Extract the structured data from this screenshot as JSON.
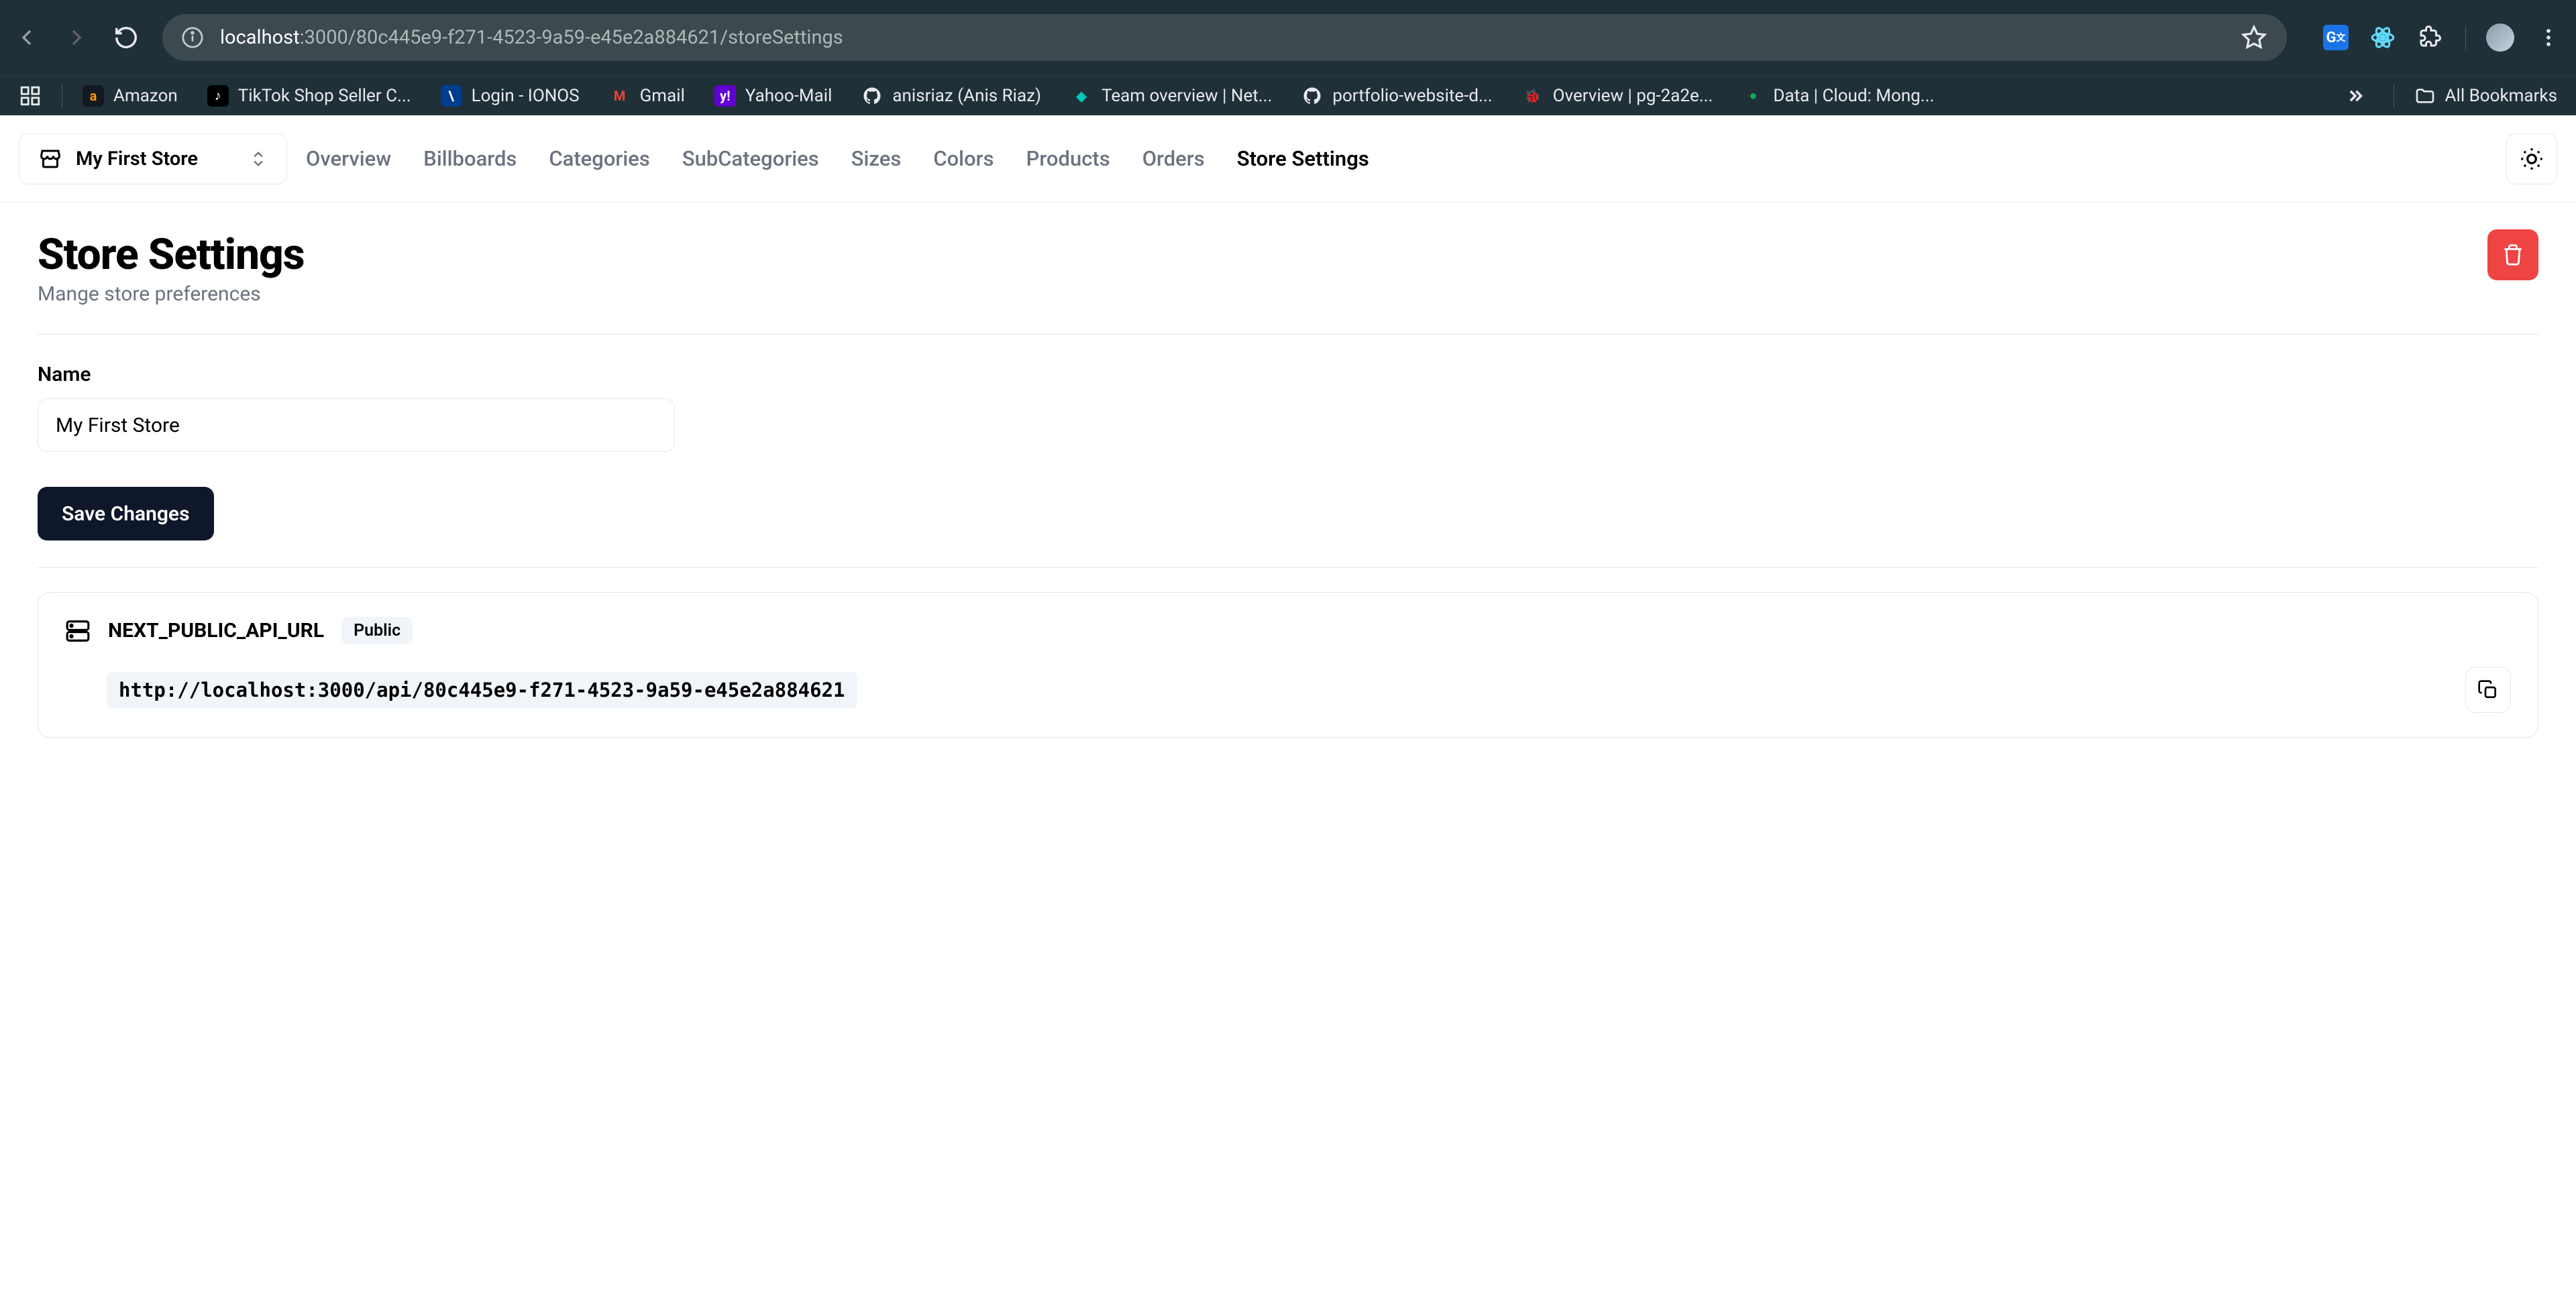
{
  "browser": {
    "url_host": "localhost",
    "url_port_path": ":3000/80c445e9-f271-4523-9a59-e45e2a884621/storeSettings"
  },
  "bookmarks": [
    {
      "label": "Amazon",
      "bg": "#131921",
      "glyph": "a",
      "color": "#ff9900"
    },
    {
      "label": "TikTok Shop Seller C...",
      "bg": "#000",
      "glyph": "♪",
      "color": "#fff"
    },
    {
      "label": "Login - IONOS",
      "bg": "#003d8f",
      "glyph": "\\",
      "color": "#fff"
    },
    {
      "label": "Gmail",
      "bg": "transparent",
      "glyph": "M",
      "color": "#ea4335"
    },
    {
      "label": "Yahoo-Mail",
      "bg": "#6001d2",
      "glyph": "y!",
      "color": "#fff"
    },
    {
      "label": "anisriaz (Anis Riaz)",
      "bg": "#000",
      "glyph": "⬤",
      "color": "#fff",
      "github": true
    },
    {
      "label": "Team overview | Net...",
      "bg": "transparent",
      "glyph": "◆",
      "color": "#00c7b7"
    },
    {
      "label": "portfolio-website-d...",
      "bg": "#000",
      "glyph": "⬤",
      "color": "#fff",
      "github": true
    },
    {
      "label": "Overview | pg-2a2e...",
      "bg": "transparent",
      "glyph": "🐞",
      "color": "#d63384"
    },
    {
      "label": "Data | Cloud: Mong...",
      "bg": "transparent",
      "glyph": "●",
      "color": "#13aa52"
    }
  ],
  "all_bookmarks_label": "All Bookmarks",
  "store_switcher": {
    "label": "My First Store"
  },
  "nav": [
    {
      "label": "Overview",
      "active": false
    },
    {
      "label": "Billboards",
      "active": false
    },
    {
      "label": "Categories",
      "active": false
    },
    {
      "label": "SubCategories",
      "active": false
    },
    {
      "label": "Sizes",
      "active": false
    },
    {
      "label": "Colors",
      "active": false
    },
    {
      "label": "Products",
      "active": false
    },
    {
      "label": "Orders",
      "active": false
    },
    {
      "label": "Store Settings",
      "active": true
    }
  ],
  "page": {
    "title": "Store Settings",
    "subtitle": "Mange store preferences",
    "name_label": "Name",
    "name_value": "My First Store",
    "save_label": "Save Changes"
  },
  "api": {
    "var_name": "NEXT_PUBLIC_API_URL",
    "badge": "Public",
    "url": "http://localhost:3000/api/80c445e9-f271-4523-9a59-e45e2a884621"
  }
}
